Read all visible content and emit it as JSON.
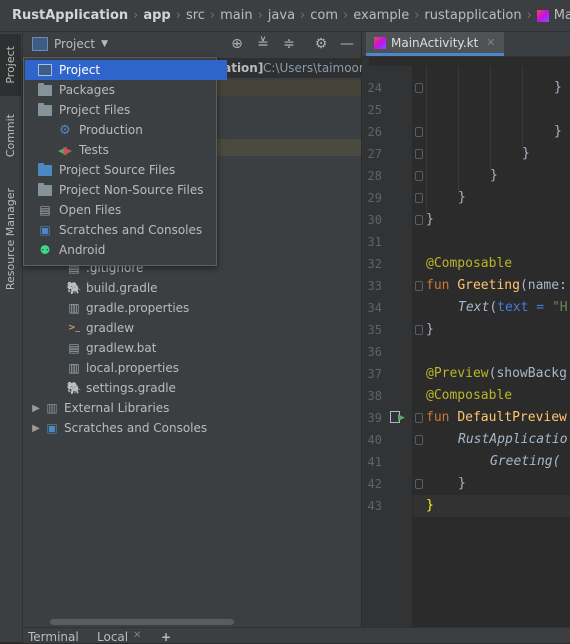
{
  "breadcrumb": {
    "items": [
      "RustApplication",
      "app",
      "src",
      "main",
      "java",
      "com",
      "example",
      "rustapplication",
      "MainActivity.kt"
    ]
  },
  "left_strip": {
    "tabs": [
      "Project",
      "Commit",
      "Resource Manager"
    ]
  },
  "project_panel": {
    "view_selector_label": "Project",
    "project_path_fragment": "cation]",
    "project_path": "C:\\Users\\taimoor\\A",
    "tree": [
      {
        "label": ".gitignore",
        "icon": "file-icon"
      },
      {
        "label": "build.gradle",
        "icon": "gradle-icon"
      },
      {
        "label": "gradle.properties",
        "icon": "gradle-icon"
      },
      {
        "label": "gradlew",
        "icon": "shell-file-icon"
      },
      {
        "label": "gradlew.bat",
        "icon": "file-icon"
      },
      {
        "label": "local.properties",
        "icon": "file-icon"
      },
      {
        "label": "settings.gradle",
        "icon": "gradle-icon"
      },
      {
        "label": "External Libraries",
        "icon": "library-icon"
      },
      {
        "label": "Scratches and Consoles",
        "icon": "scratches-icon"
      }
    ]
  },
  "view_popup": {
    "items": [
      {
        "label": "Project",
        "icon": "project-icon",
        "selected": true
      },
      {
        "label": "Packages",
        "icon": "folder-icon"
      },
      {
        "label": "Project Files",
        "icon": "folder-icon"
      },
      {
        "label": "Production",
        "icon": "gear-icon"
      },
      {
        "label": "Tests",
        "icon": "tests-icon"
      },
      {
        "label": "Project Source Files",
        "icon": "folder-icon"
      },
      {
        "label": "Project Non-Source Files",
        "icon": "folder-icon"
      },
      {
        "label": "Open Files",
        "icon": "file-icon"
      },
      {
        "label": "Scratches and Consoles",
        "icon": "scratches-icon"
      },
      {
        "label": "Android",
        "icon": "android-icon"
      }
    ]
  },
  "editor": {
    "tab_label": "MainActivity.kt",
    "line_numbers": [
      "24",
      "25",
      "26",
      "27",
      "28",
      "29",
      "30",
      "31",
      "32",
      "33",
      "34",
      "35",
      "36",
      "37",
      "38",
      "39",
      "40",
      "41",
      "42",
      "43"
    ],
    "code": {
      "l24": "}",
      "l26": "}",
      "l27": "}",
      "l28": "}",
      "l29": "}",
      "l30": "}",
      "l32": "@Composable",
      "l33_kw": "fun ",
      "l33_fn": "Greeting",
      "l33_rest": "(name:",
      "l34_fn": "Text",
      "l34_open": "(",
      "l34_param": "text = ",
      "l34_str": "\"H",
      "l35": "}",
      "l37_ann": "@Preview",
      "l37_rest": "(showBackg",
      "l38": "@Composable",
      "l39_kw": "fun ",
      "l39_fn": "DefaultPreview",
      "l40": "RustApplicatio",
      "l41": "Greeting(",
      "l42": "}",
      "l43": "}"
    }
  },
  "bottom": {
    "tabs": [
      "Terminal",
      "Local",
      "+"
    ]
  },
  "colors": {
    "accent": "#2f65ca",
    "keyword": "#cc7832",
    "annotation": "#bbb529",
    "function": "#ffc66d"
  }
}
